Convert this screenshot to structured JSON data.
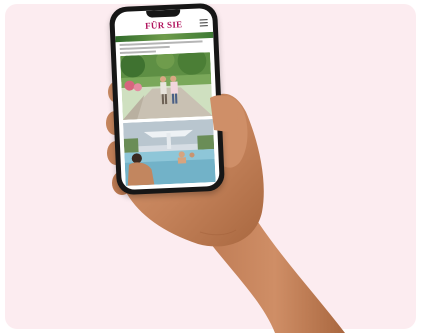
{
  "site": {
    "logo_text": "FÜR SIE"
  },
  "icons": {
    "menu": "hamburger-menu-icon"
  },
  "colors": {
    "background": "#fcecf0",
    "logo": "#b0125c",
    "phone_frame": "#161616",
    "skin": "#c98a63"
  }
}
